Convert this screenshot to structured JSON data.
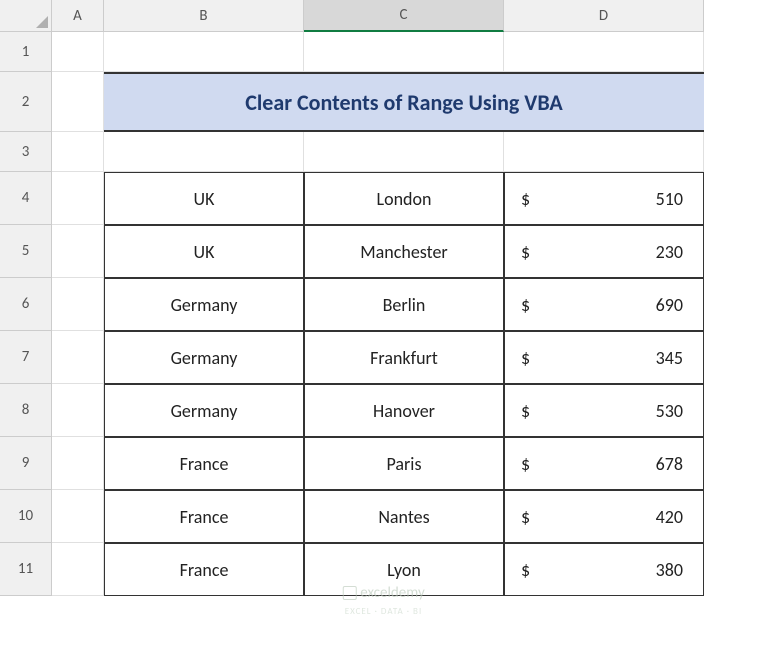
{
  "columns": [
    "A",
    "B",
    "C",
    "D"
  ],
  "rows": [
    "1",
    "2",
    "3",
    "4",
    "5",
    "6",
    "7",
    "8",
    "9",
    "10",
    "11"
  ],
  "selectedColumn": "C",
  "title": "Clear Contents of Range Using VBA",
  "tableData": [
    {
      "country": "UK",
      "city": "London",
      "currency": "$",
      "amount": "510"
    },
    {
      "country": "UK",
      "city": "Manchester",
      "currency": "$",
      "amount": "230"
    },
    {
      "country": "Germany",
      "city": "Berlin",
      "currency": "$",
      "amount": "690"
    },
    {
      "country": "Germany",
      "city": "Frankfurt",
      "currency": "$",
      "amount": "345"
    },
    {
      "country": "Germany",
      "city": "Hanover",
      "currency": "$",
      "amount": "530"
    },
    {
      "country": "France",
      "city": "Paris",
      "currency": "$",
      "amount": "678"
    },
    {
      "country": "France",
      "city": "Nantes",
      "currency": "$",
      "amount": "420"
    },
    {
      "country": "France",
      "city": "Lyon",
      "currency": "$",
      "amount": "380"
    }
  ],
  "watermark": {
    "text": "exceldemy",
    "subtitle": "EXCEL · DATA · BI"
  }
}
